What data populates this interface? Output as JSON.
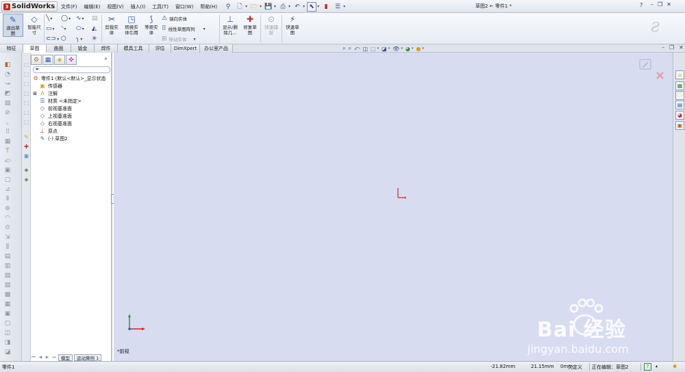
{
  "app": {
    "name": "SolidWorks",
    "doc_title": "草图2 ← 零件1 *"
  },
  "menu": [
    "文件(F)",
    "编辑(E)",
    "视图(V)",
    "插入(I)",
    "工具(T)",
    "窗口(W)",
    "帮助(H)"
  ],
  "title_controls": {
    "help": "?",
    "minimize": "–",
    "restore": "❐",
    "close": "✕"
  },
  "commands": {
    "exit_sketch": "退出草\n图",
    "smart_dim": "智能尺\n寸",
    "trim": "剪裁实\n体",
    "convert": "转换实\n体引用",
    "offset": "等距实\n体",
    "mirror": "镜向实体",
    "linear_pattern": "线性草图阵列",
    "move_entities": "移动实体",
    "display_delete": "显示/删\n除几...",
    "repair": "修复草\n图",
    "quick_snaps": "快速捕\n捉",
    "rapid_sketch": "快速草\n图"
  },
  "tabs": [
    "特征",
    "草图",
    "曲面",
    "钣金",
    "焊件",
    "模具工具",
    "评估",
    "DimXpert",
    "办公室产品"
  ],
  "active_tab": 1,
  "feature_tree": {
    "root": "零件1  (默认<默认>_显示状态",
    "items": [
      {
        "label": "传感器",
        "icon": "sensor-icon"
      },
      {
        "label": "注解",
        "icon": "annotation-icon"
      },
      {
        "label": "材质 <未指定>",
        "icon": "material-icon"
      },
      {
        "label": "前视基准面",
        "icon": "plane-icon"
      },
      {
        "label": "上视基准面",
        "icon": "plane-icon"
      },
      {
        "label": "右视基准面",
        "icon": "plane-icon"
      },
      {
        "label": "原点",
        "icon": "origin-icon"
      },
      {
        "label": "(-) 草图2",
        "icon": "sketch-icon"
      }
    ],
    "bottom_tabs": [
      "模型",
      "运动算例 1"
    ],
    "expand": "»"
  },
  "canvas": {
    "view_name": "*前视"
  },
  "watermark": {
    "brand": "Bai  经验",
    "url": "jingyan.baidu.com"
  },
  "status": {
    "left": "零件1",
    "x": "-21.82mm",
    "y": "21.15mm",
    "z": "0mm",
    "state": "欠定义",
    "editing": "正在编辑：草图2"
  },
  "colors": {
    "canvas": "#d7dcf1",
    "accent": "#c8231c",
    "axis_x": "#d02020",
    "axis_y": "#2a9a2a"
  }
}
